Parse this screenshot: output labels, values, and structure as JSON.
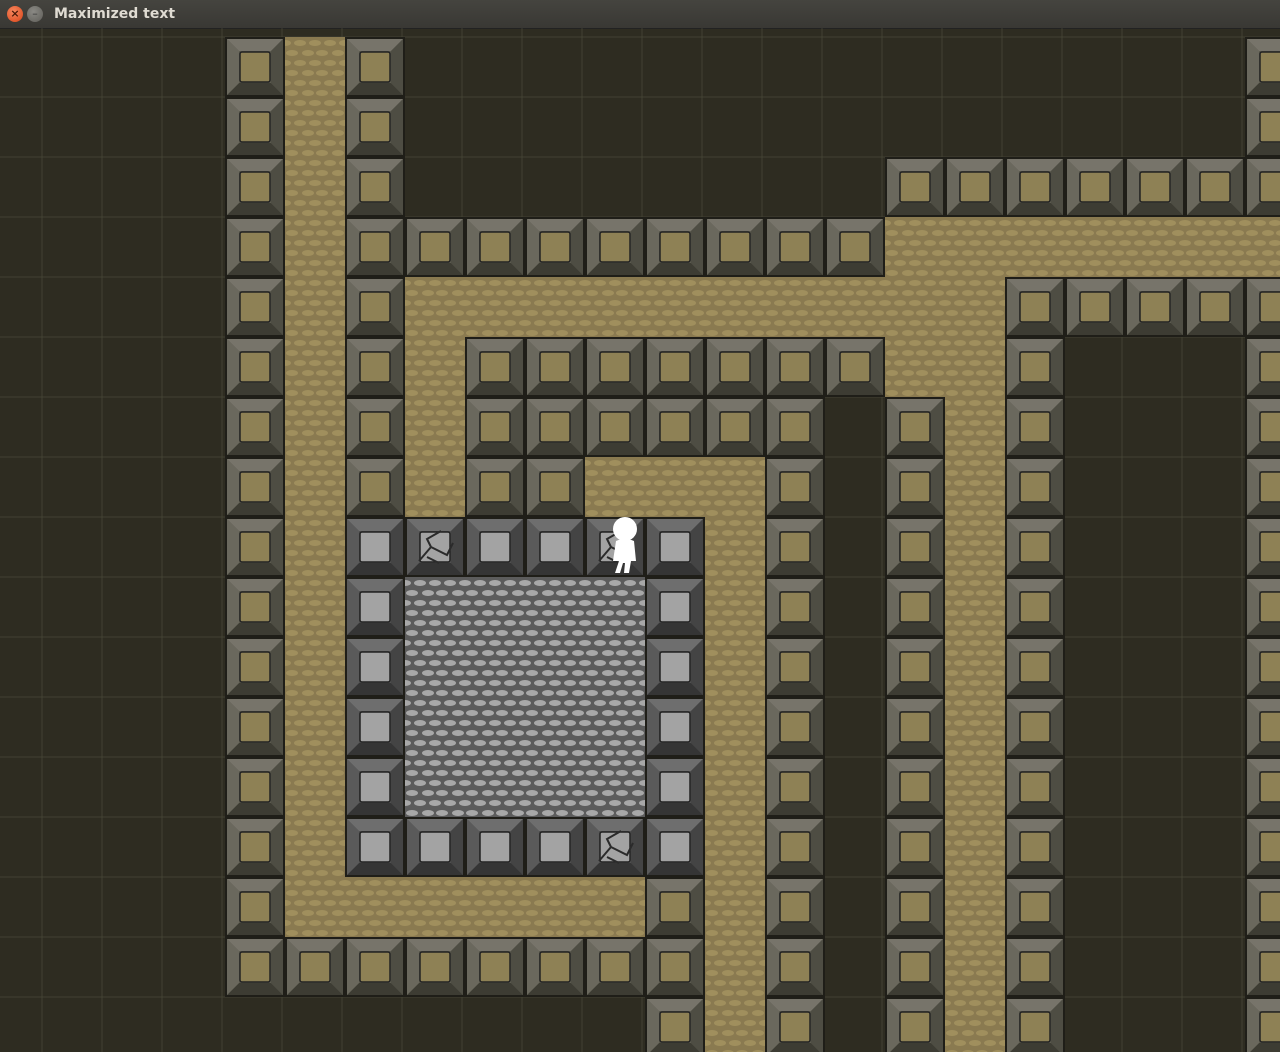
{
  "window": {
    "title": "Maximized text",
    "close_glyph": "×",
    "minimize_glyph": "–"
  },
  "colors": {
    "background": "#2e2c21",
    "grid_line": "#4a4a3a",
    "brown_block_frame": "#5b5a4e",
    "brown_block_face": "#8e8155",
    "brown_floor": "#8a7a50",
    "gray_block_frame": "#4f4f4f",
    "gray_block_face": "#a3a3a3",
    "gray_floor": "#a8a8a8",
    "player": "#ffffff"
  },
  "map": {
    "legend": {
      ".": "empty",
      "B": "brown-block",
      "F": "brown-floor",
      "G": "gray-block",
      "C": "gray-block-cracked",
      "S": "gray-floor",
      "P": "player"
    },
    "rows": [
      "..BFB..............B",
      "..BFB..............B",
      "..BFB........BBBBBBB",
      "..BFBBBBBBBBBFFFFFFF",
      "..BFBFFFFFFFFFFBBBBB",
      "..BFBFBBBBBBBFFB...B",
      "..BFBFBBBBBB.BFB...B",
      "..BFBFBBFFFB.BFB...B",
      "..BFGCGGCGFB.BFB...B",
      "..BFGSSSSGFB.BFB...B",
      "..BFGSSSSGFB.BFB...B",
      "..BFGSSSSGFB.BFB...B",
      "..BFGSSSSGFB.BFB...B",
      "..BFGGGGCGFB.BFB...B",
      "..BFFFFFFBFB.BFB...B",
      "..BBBBBBBBFB.BFB...B",
      ".........BFB.BFB...B"
    ],
    "player": {
      "row": 8,
      "col": 10,
      "name": "stick-figure"
    }
  }
}
